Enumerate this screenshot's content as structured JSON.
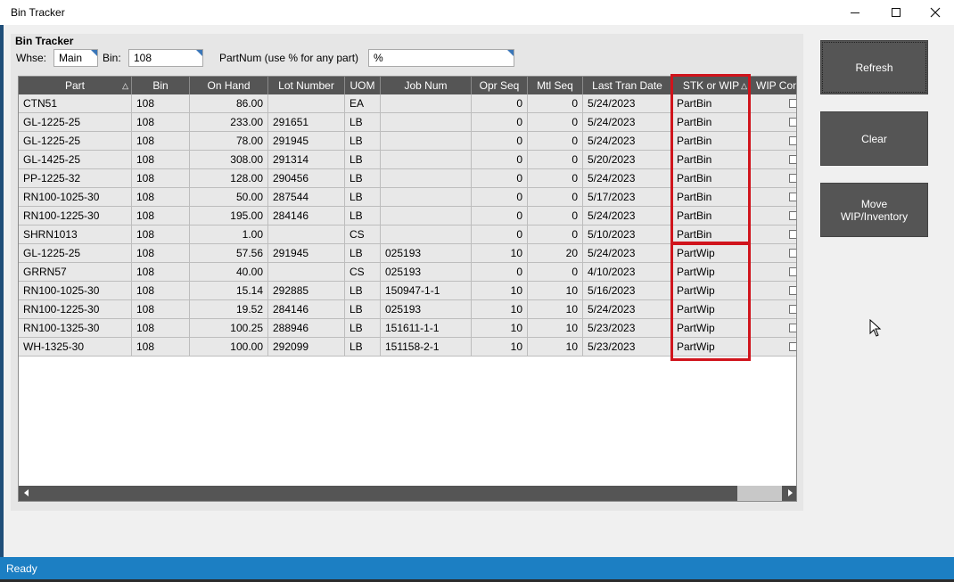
{
  "window": {
    "title": "Bin Tracker"
  },
  "panel": {
    "title": "Bin Tracker",
    "whse_label": "Whse:",
    "whse_value": "Main",
    "bin_label": "Bin:",
    "bin_value": "108",
    "partnum_label": "PartNum (use % for any part)",
    "partnum_value": "%"
  },
  "grid": {
    "columns": [
      "Part",
      "Bin",
      "On Hand",
      "Lot Number",
      "UOM",
      "Job Num",
      "Opr Seq",
      "Mtl Seq",
      "Last Tran Date",
      "STK or WIP",
      "WIP Con"
    ],
    "rows": [
      [
        "CTN51",
        "108",
        "86.00",
        "",
        "EA",
        "",
        "0",
        "0",
        "5/24/2023",
        "PartBin"
      ],
      [
        "GL-1225-25",
        "108",
        "233.00",
        "291651",
        "LB",
        "",
        "0",
        "0",
        "5/24/2023",
        "PartBin"
      ],
      [
        "GL-1225-25",
        "108",
        "78.00",
        "291945",
        "LB",
        "",
        "0",
        "0",
        "5/24/2023",
        "PartBin"
      ],
      [
        "GL-1425-25",
        "108",
        "308.00",
        "291314",
        "LB",
        "",
        "0",
        "0",
        "5/20/2023",
        "PartBin"
      ],
      [
        "PP-1225-32",
        "108",
        "128.00",
        "290456",
        "LB",
        "",
        "0",
        "0",
        "5/24/2023",
        "PartBin"
      ],
      [
        "RN100-1025-30",
        "108",
        "50.00",
        "287544",
        "LB",
        "",
        "0",
        "0",
        "5/17/2023",
        "PartBin"
      ],
      [
        "RN100-1225-30",
        "108",
        "195.00",
        "284146",
        "LB",
        "",
        "0",
        "0",
        "5/24/2023",
        "PartBin"
      ],
      [
        "SHRN1013",
        "108",
        "1.00",
        "",
        "CS",
        "",
        "0",
        "0",
        "5/10/2023",
        "PartBin"
      ],
      [
        "GL-1225-25",
        "108",
        "57.56",
        "291945",
        "LB",
        "025193",
        "10",
        "20",
        "5/24/2023",
        "PartWip"
      ],
      [
        "GRRN57",
        "108",
        "40.00",
        "",
        "CS",
        "025193",
        "0",
        "0",
        "4/10/2023",
        "PartWip"
      ],
      [
        "RN100-1025-30",
        "108",
        "15.14",
        "292885",
        "LB",
        "150947-1-1",
        "10",
        "10",
        "5/16/2023",
        "PartWip"
      ],
      [
        "RN100-1225-30",
        "108",
        "19.52",
        "284146",
        "LB",
        "025193",
        "10",
        "10",
        "5/24/2023",
        "PartWip"
      ],
      [
        "RN100-1325-30",
        "108",
        "100.25",
        "288946",
        "LB",
        "151611-1-1",
        "10",
        "10",
        "5/23/2023",
        "PartWip"
      ],
      [
        "WH-1325-30",
        "108",
        "100.00",
        "292099",
        "LB",
        "151158-2-1",
        "10",
        "10",
        "5/23/2023",
        "PartWip"
      ]
    ]
  },
  "buttons": {
    "refresh": "Refresh",
    "clear": "Clear",
    "move": "Move\nWIP/Inventory"
  },
  "status": {
    "text": "Ready"
  },
  "colors": {
    "highlight": "#d0141c",
    "header_bg": "#555555",
    "statusbar": "#1c7fc3"
  }
}
